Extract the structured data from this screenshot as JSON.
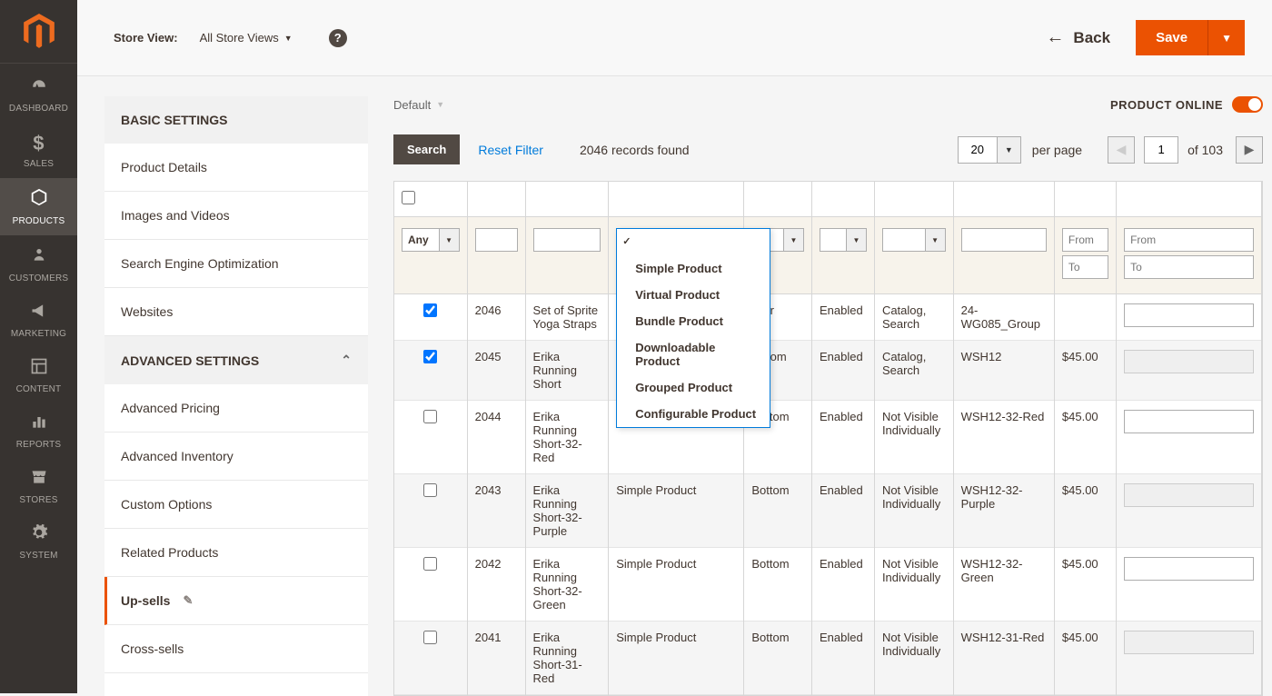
{
  "nav": {
    "items": [
      {
        "label": "DASHBOARD",
        "icon": "dashboard"
      },
      {
        "label": "SALES",
        "icon": "sales"
      },
      {
        "label": "PRODUCTS",
        "icon": "products"
      },
      {
        "label": "CUSTOMERS",
        "icon": "customers"
      },
      {
        "label": "MARKETING",
        "icon": "marketing"
      },
      {
        "label": "CONTENT",
        "icon": "content"
      },
      {
        "label": "REPORTS",
        "icon": "reports"
      },
      {
        "label": "STORES",
        "icon": "stores"
      },
      {
        "label": "SYSTEM",
        "icon": "system"
      }
    ]
  },
  "topbar": {
    "store_view_label": "Store View:",
    "store_view_value": "All Store Views",
    "back_label": "Back",
    "save_label": "Save"
  },
  "settings": {
    "basic_header": "BASIC SETTINGS",
    "advanced_header": "ADVANCED SETTINGS",
    "basic_tabs": [
      "Product Details",
      "Images and Videos",
      "Search Engine Optimization",
      "Websites"
    ],
    "advanced_tabs": [
      "Advanced Pricing",
      "Advanced Inventory",
      "Custom Options",
      "Related Products",
      "Up-sells",
      "Cross-sells"
    ]
  },
  "grid_header": {
    "default_label": "Default",
    "status_label": "PRODUCT ONLINE"
  },
  "controls": {
    "search_label": "Search",
    "reset_label": "Reset Filter",
    "records_found": "2046 records found",
    "per_page_value": "20",
    "per_page_label": "per page",
    "current_page": "1",
    "of_pages": "of 103"
  },
  "filters": {
    "any_label": "Any",
    "from_placeholder": "From",
    "to_placeholder": "To"
  },
  "type_options": [
    "",
    "Simple Product",
    "Virtual Product",
    "Bundle Product",
    "Downloadable Product",
    "Grouped Product",
    "Configurable Product"
  ],
  "rows": [
    {
      "checked": true,
      "id": "2046",
      "name": "Set of Sprite Yoga Straps",
      "type": "",
      "attr_trunc": "ar",
      "status": "Enabled",
      "visibility": "Catalog, Search",
      "sku": "24-WG085_Group",
      "price": "",
      "even": false
    },
    {
      "checked": true,
      "id": "2045",
      "name": "Erika Running Short",
      "type": "",
      "attr_trunc": "ttom",
      "status": "Enabled",
      "visibility": "Catalog, Search",
      "sku": "WSH12",
      "price": "$45.00",
      "even": true
    },
    {
      "checked": false,
      "id": "2044",
      "name": "Erika Running Short-32-Red",
      "type": "Simple Product",
      "attr": "Bottom",
      "status": "Enabled",
      "visibility": "Not Visible Individually",
      "sku": "WSH12-32-Red",
      "price": "$45.00",
      "even": false
    },
    {
      "checked": false,
      "id": "2043",
      "name": "Erika Running Short-32-Purple",
      "type": "Simple Product",
      "attr": "Bottom",
      "status": "Enabled",
      "visibility": "Not Visible Individually",
      "sku": "WSH12-32-Purple",
      "price": "$45.00",
      "even": true
    },
    {
      "checked": false,
      "id": "2042",
      "name": "Erika Running Short-32-Green",
      "type": "Simple Product",
      "attr": "Bottom",
      "status": "Enabled",
      "visibility": "Not Visible Individually",
      "sku": "WSH12-32-Green",
      "price": "$45.00",
      "even": false
    },
    {
      "checked": false,
      "id": "2041",
      "name": "Erika Running Short-31-Red",
      "type": "Simple Product",
      "attr": "Bottom",
      "status": "Enabled",
      "visibility": "Not Visible Individually",
      "sku": "WSH12-31-Red",
      "price": "$45.00",
      "even": true
    }
  ]
}
